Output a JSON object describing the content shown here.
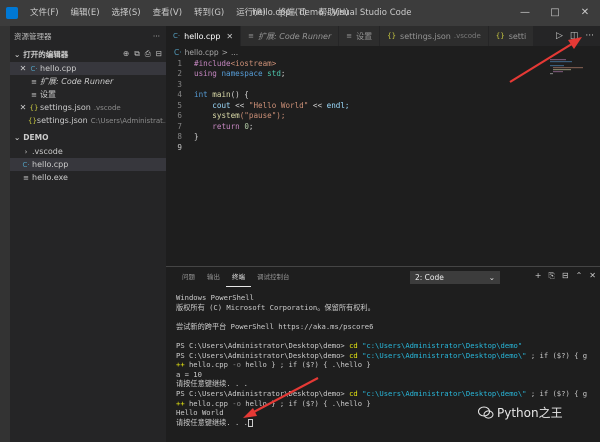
{
  "window": {
    "menu": [
      "文件(F)",
      "编辑(E)",
      "选择(S)",
      "查看(V)",
      "转到(G)",
      "运行(R)",
      "终端(T)",
      "帮助(H)"
    ],
    "title": "hello.cpp - demo - Visual Studio Code",
    "controls": [
      "—",
      "□",
      "✕"
    ]
  },
  "sidebar": {
    "header": "资源管理器",
    "header_more": "···",
    "open_editors_title": "打开的编辑器",
    "open_editors_actions": [
      "⊕",
      "⧉",
      "⎙",
      "⊟"
    ],
    "open_editors": [
      {
        "close": "✕",
        "icon": "C·",
        "name": "hello.cpp",
        "hint": "",
        "selected": true,
        "italic": false
      },
      {
        "close": "",
        "icon": "≡",
        "name": "扩展: Code Runner",
        "hint": "",
        "selected": false,
        "italic": true
      },
      {
        "close": "",
        "icon": "≡",
        "name": "设置",
        "hint": "",
        "selected": false,
        "italic": false
      },
      {
        "close": "✕",
        "icon": "{}",
        "name": "settings.json",
        "hint": ".vscode",
        "selected": false,
        "italic": false
      },
      {
        "close": "",
        "icon": "{}",
        "name": "settings.json",
        "hint": "C:\\Users\\Administrat...",
        "selected": false,
        "italic": false
      }
    ],
    "workspace_title": "DEMO",
    "tree": [
      {
        "indent": 0,
        "icon": "›",
        "name": ".vscode",
        "selected": false
      },
      {
        "indent": 0,
        "icon": "C·",
        "name": "hello.cpp",
        "selected": true
      },
      {
        "indent": 0,
        "icon": "≡",
        "name": "hello.exe",
        "selected": false
      }
    ]
  },
  "tabs": [
    {
      "icon": "C·",
      "label": "hello.cpp",
      "hint": "",
      "active": true,
      "close": "✕"
    },
    {
      "icon": "≡",
      "label": "扩展: Code Runner",
      "hint": "",
      "active": false,
      "close": ""
    },
    {
      "icon": "≡",
      "label": "设置",
      "hint": "",
      "active": false,
      "close": ""
    },
    {
      "icon": "{}",
      "label": "settings.json",
      "hint": ".vscode",
      "active": false,
      "close": ""
    },
    {
      "icon": "{}",
      "label": "setti",
      "hint": "",
      "active": false,
      "close": ""
    }
  ],
  "tab_actions": [
    "▷",
    "◫",
    "···"
  ],
  "breadcrumb": {
    "icon": "C·",
    "file": "hello.cpp",
    "sep": ">",
    "more": "..."
  },
  "code_lines": [
    "1",
    "2",
    "3",
    "4",
    "5",
    "6",
    "7",
    "8",
    "9"
  ],
  "code": {
    "include_kw": "#include",
    "include_file": "<iostream>",
    "using": "using",
    "namespace": "namespace",
    "std": "std",
    "semi": ";",
    "int": "int",
    "main": "main",
    "paren_brace": "() {",
    "cout": "cout",
    "shift": " << ",
    "hello_str": "\"Hello World\"",
    "endl": "endl;",
    "system": "system",
    "pause_str": "(\"pause\");",
    "return": "return",
    "zero": "0",
    "close_brace": "}"
  },
  "panel": {
    "tabs": [
      "问题",
      "输出",
      "终端",
      "调试控制台"
    ],
    "active_tab": "终端",
    "terminal_select": "2: Code",
    "terminal_select_arrow": "⌄",
    "actions": [
      "+",
      "⎘",
      "⊟",
      "⌃",
      "✕"
    ]
  },
  "terminal": {
    "l1": "Windows PowerShell",
    "l2": "版权所有 (C) Microsoft Corporation。保留所有权利。",
    "l3": "尝试新的跨平台 PowerShell https://aka.ms/pscore6",
    "ps1_prompt": "PS C:\\Users\\Administrator\\Desktop\\demo> ",
    "ps1_cd": "cd",
    "ps1_path": " \"c:\\Users\\Administrator\\Desktop\\demo\"",
    "ps2_prompt": "PS C:\\Users\\Administrator\\Desktop\\demo> ",
    "ps2_cd": "cd",
    "ps2_path": " \"c:\\Users\\Administrator\\Desktop\\demo\\\"",
    "ps2_rest": " ; if ($?) { g",
    "cont1_pp": "++",
    "cont1_file": " hello.cpp ",
    "cont1_o": "-o",
    "cont1_rest": " hello } ; if ($?) { .\\hello }",
    "out_a": "a = 10",
    "out_pause1": "请按任意键继续. . .",
    "ps3_prompt": "PS C:\\Users\\Administrator\\Desktop\\demo> ",
    "ps3_cd": "cd",
    "ps3_path": " \"c:\\Users\\Administrator\\Desktop\\demo\\\"",
    "ps3_rest": " ; if ($?) { g",
    "cont2_pp": "++",
    "cont2_file": " hello.cpp ",
    "cont2_o": "-o",
    "cont2_rest": " hello } ; if ($?) { .\\hello }",
    "out_hello": "Hello World",
    "out_pause2": "请按任意键继续. . ."
  },
  "watermark": {
    "text": "Python之王"
  },
  "colors": {
    "annotation_arrow": "#e53935",
    "accent": "#007acc"
  }
}
